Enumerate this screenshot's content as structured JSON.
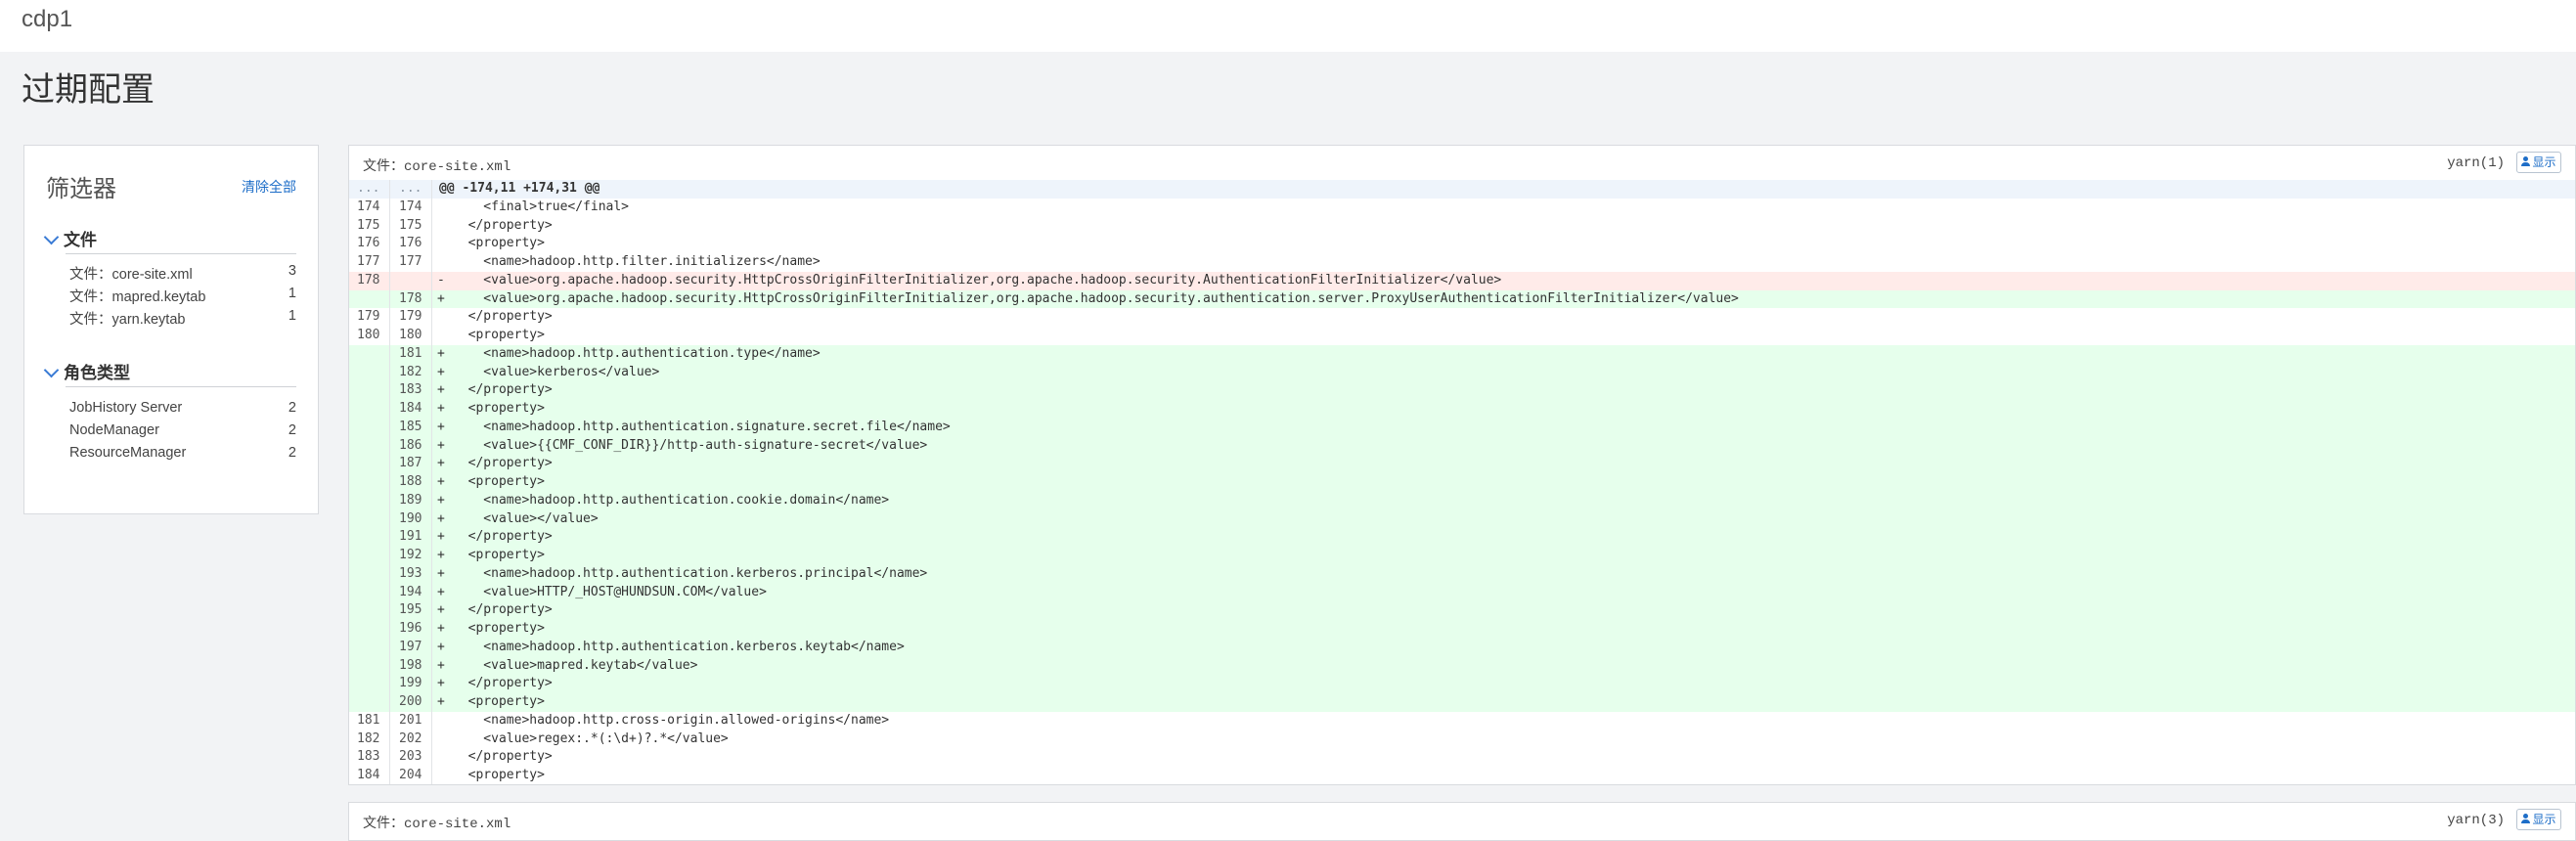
{
  "header": {
    "cluster": "cdp1",
    "page_title": "过期配置"
  },
  "filter": {
    "title": "筛选器",
    "clear_all": "清除全部",
    "sections": [
      {
        "label": "文件",
        "items": [
          {
            "label": "文件：core-site.xml",
            "count": "3"
          },
          {
            "label": "文件：mapred.keytab",
            "count": "1"
          },
          {
            "label": "文件：yarn.keytab",
            "count": "1"
          }
        ]
      },
      {
        "label": "角色类型",
        "items": [
          {
            "label": "JobHistory Server",
            "count": "2"
          },
          {
            "label": "NodeManager",
            "count": "2"
          },
          {
            "label": "ResourceManager",
            "count": "2"
          }
        ]
      }
    ]
  },
  "diffs": [
    {
      "file": "文件：core-site.xml",
      "role": "yarn(1)",
      "button": "显示",
      "lines": [
        {
          "type": "hunk",
          "old": "...",
          "new": "...",
          "marker": "",
          "code": "@@ -174,11 +174,31 @@"
        },
        {
          "type": "ctx",
          "old": "174",
          "new": "174",
          "marker": "",
          "code": "    <final>true</final>"
        },
        {
          "type": "ctx",
          "old": "175",
          "new": "175",
          "marker": "",
          "code": "  </property>"
        },
        {
          "type": "ctx",
          "old": "176",
          "new": "176",
          "marker": "",
          "code": "  <property>"
        },
        {
          "type": "ctx",
          "old": "177",
          "new": "177",
          "marker": "",
          "code": "    <name>hadoop.http.filter.initializers</name>"
        },
        {
          "type": "del",
          "old": "178",
          "new": "",
          "marker": "-",
          "code": "    <value>org.apache.hadoop.security.HttpCrossOriginFilterInitializer,org.apache.hadoop.security.AuthenticationFilterInitializer</value>"
        },
        {
          "type": "add",
          "old": "",
          "new": "178",
          "marker": "+",
          "code": "    <value>org.apache.hadoop.security.HttpCrossOriginFilterInitializer,org.apache.hadoop.security.authentication.server.ProxyUserAuthenticationFilterInitializer</value>"
        },
        {
          "type": "ctx",
          "old": "179",
          "new": "179",
          "marker": "",
          "code": "  </property>"
        },
        {
          "type": "ctx",
          "old": "180",
          "new": "180",
          "marker": "",
          "code": "  <property>"
        },
        {
          "type": "add",
          "old": "",
          "new": "181",
          "marker": "+",
          "code": "    <name>hadoop.http.authentication.type</name>"
        },
        {
          "type": "add",
          "old": "",
          "new": "182",
          "marker": "+",
          "code": "    <value>kerberos</value>"
        },
        {
          "type": "add",
          "old": "",
          "new": "183",
          "marker": "+",
          "code": "  </property>"
        },
        {
          "type": "add",
          "old": "",
          "new": "184",
          "marker": "+",
          "code": "  <property>"
        },
        {
          "type": "add",
          "old": "",
          "new": "185",
          "marker": "+",
          "code": "    <name>hadoop.http.authentication.signature.secret.file</name>"
        },
        {
          "type": "add",
          "old": "",
          "new": "186",
          "marker": "+",
          "code": "    <value>{{CMF_CONF_DIR}}/http-auth-signature-secret</value>"
        },
        {
          "type": "add",
          "old": "",
          "new": "187",
          "marker": "+",
          "code": "  </property>"
        },
        {
          "type": "add",
          "old": "",
          "new": "188",
          "marker": "+",
          "code": "  <property>"
        },
        {
          "type": "add",
          "old": "",
          "new": "189",
          "marker": "+",
          "code": "    <name>hadoop.http.authentication.cookie.domain</name>"
        },
        {
          "type": "add",
          "old": "",
          "new": "190",
          "marker": "+",
          "code": "    <value></value>"
        },
        {
          "type": "add",
          "old": "",
          "new": "191",
          "marker": "+",
          "code": "  </property>"
        },
        {
          "type": "add",
          "old": "",
          "new": "192",
          "marker": "+",
          "code": "  <property>"
        },
        {
          "type": "add",
          "old": "",
          "new": "193",
          "marker": "+",
          "code": "    <name>hadoop.http.authentication.kerberos.principal</name>"
        },
        {
          "type": "add",
          "old": "",
          "new": "194",
          "marker": "+",
          "code": "    <value>HTTP/_HOST@HUNDSUN.COM</value>"
        },
        {
          "type": "add",
          "old": "",
          "new": "195",
          "marker": "+",
          "code": "  </property>"
        },
        {
          "type": "add",
          "old": "",
          "new": "196",
          "marker": "+",
          "code": "  <property>"
        },
        {
          "type": "add",
          "old": "",
          "new": "197",
          "marker": "+",
          "code": "    <name>hadoop.http.authentication.kerberos.keytab</name>"
        },
        {
          "type": "add",
          "old": "",
          "new": "198",
          "marker": "+",
          "code": "    <value>mapred.keytab</value>"
        },
        {
          "type": "add",
          "old": "",
          "new": "199",
          "marker": "+",
          "code": "  </property>"
        },
        {
          "type": "add",
          "old": "",
          "new": "200",
          "marker": "+",
          "code": "  <property>"
        },
        {
          "type": "ctx",
          "old": "181",
          "new": "201",
          "marker": "",
          "code": "    <name>hadoop.http.cross-origin.allowed-origins</name>"
        },
        {
          "type": "ctx",
          "old": "182",
          "new": "202",
          "marker": "",
          "code": "    <value>regex:.*(:\\d+)?.*</value>"
        },
        {
          "type": "ctx",
          "old": "183",
          "new": "203",
          "marker": "",
          "code": "  </property>"
        },
        {
          "type": "ctx",
          "old": "184",
          "new": "204",
          "marker": "",
          "code": "  <property>"
        }
      ]
    },
    {
      "file": "文件：core-site.xml",
      "role": "yarn(3)",
      "button": "显示",
      "lines": []
    }
  ]
}
